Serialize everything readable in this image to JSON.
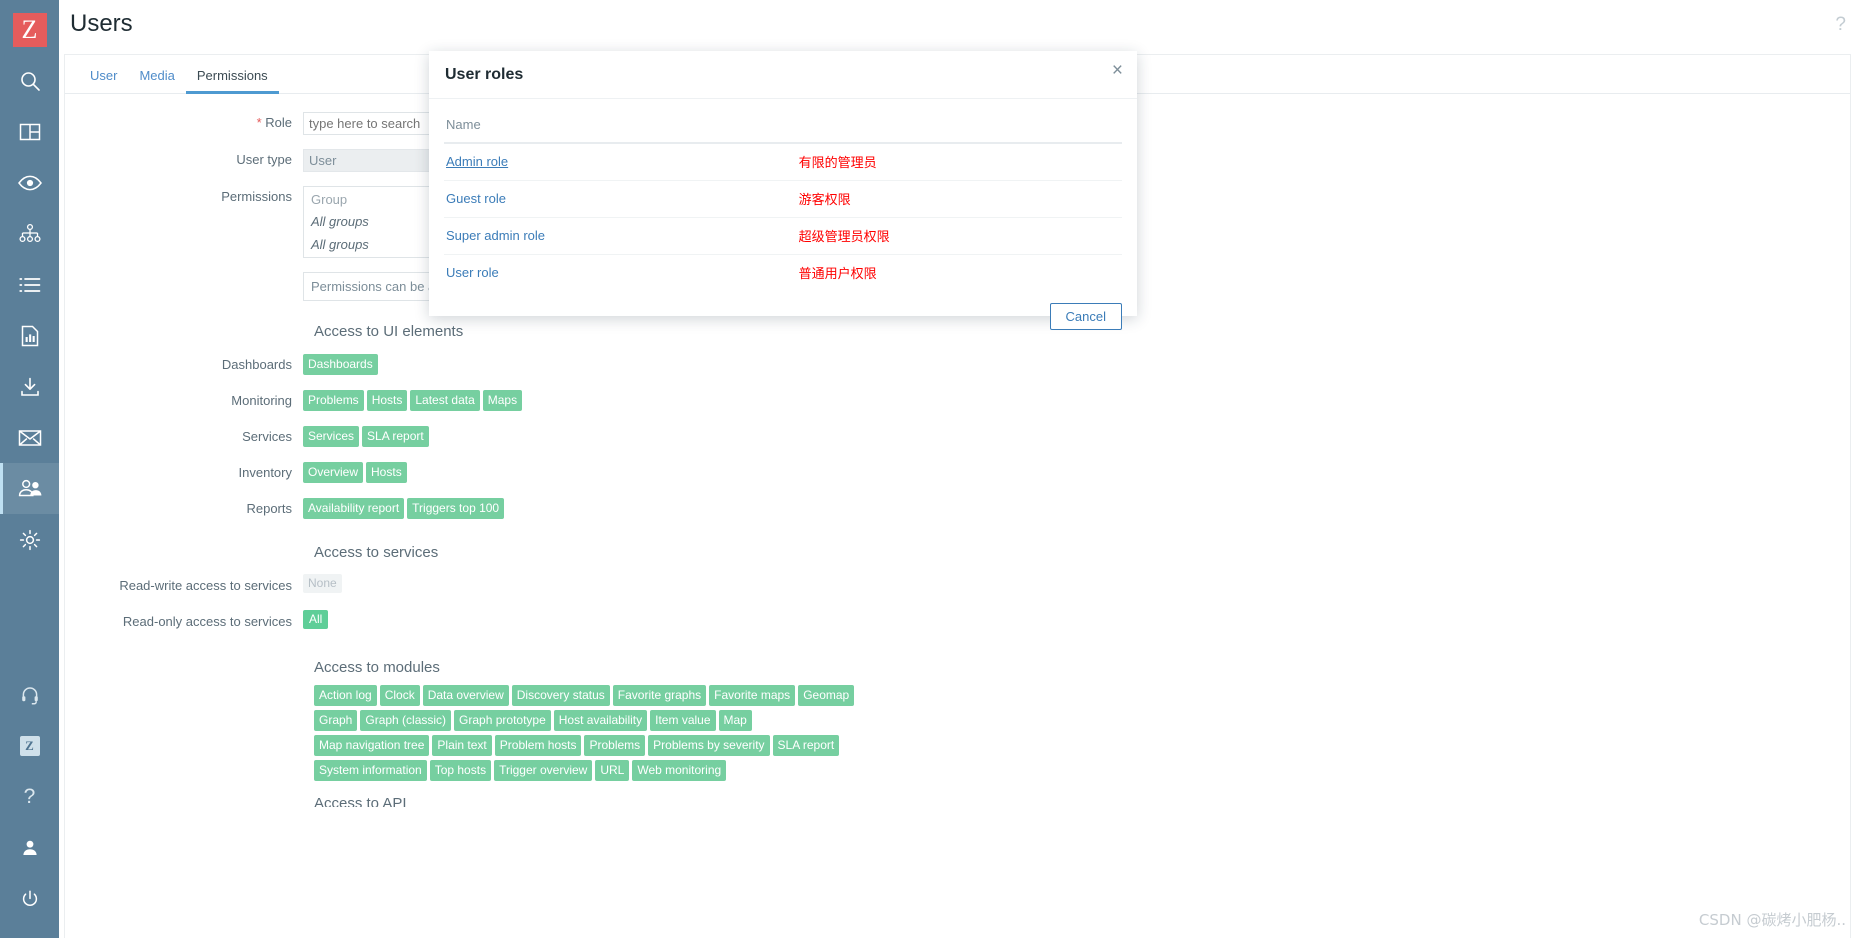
{
  "app": {
    "logo_letter": "Z",
    "page_title": "Users",
    "help_icon": "?"
  },
  "sidebar": {
    "items": [
      {
        "name": "search-icon",
        "label": "Search",
        "active": false
      },
      {
        "name": "dashboards-icon",
        "label": "Dashboards",
        "active": false
      },
      {
        "name": "monitoring-eye-icon",
        "label": "Monitoring",
        "active": false
      },
      {
        "name": "services-tree-icon",
        "label": "Services",
        "active": false
      },
      {
        "name": "inventory-list-icon",
        "label": "Inventory",
        "active": false
      },
      {
        "name": "reports-chart-icon",
        "label": "Reports",
        "active": false
      },
      {
        "name": "data-collection-icon",
        "label": "Data collection",
        "active": false
      },
      {
        "name": "alerts-envelope-icon",
        "label": "Alerts",
        "active": false
      },
      {
        "name": "users-icon",
        "label": "Users",
        "active": true
      },
      {
        "name": "administration-gear-icon",
        "label": "Administration",
        "active": false
      }
    ],
    "bottom_items": [
      {
        "name": "support-headset-icon",
        "label": "Support"
      },
      {
        "name": "zabbix-integrations-icon",
        "label": "Integrations",
        "glyph": "Z"
      },
      {
        "name": "help-question-icon",
        "label": "Help",
        "glyph": "?"
      },
      {
        "name": "user-profile-icon",
        "label": "User settings"
      },
      {
        "name": "power-signout-icon",
        "label": "Sign out"
      }
    ]
  },
  "tabs": [
    {
      "label": "User",
      "selected": false
    },
    {
      "label": "Media",
      "selected": false
    },
    {
      "label": "Permissions",
      "selected": true
    }
  ],
  "form": {
    "role": {
      "label": "Role",
      "required_marker": "*",
      "placeholder": "type here to search",
      "value": ""
    },
    "user_type": {
      "label": "User type",
      "value": "User"
    },
    "permissions": {
      "label": "Permissions",
      "column_header": "Group",
      "rows": [
        "All groups",
        "All groups"
      ],
      "note": "Permissions can be a"
    }
  },
  "ui_elements": {
    "title": "Access to UI elements",
    "groups": [
      {
        "label": "Dashboards",
        "tags": [
          "Dashboards"
        ]
      },
      {
        "label": "Monitoring",
        "tags": [
          "Problems",
          "Hosts",
          "Latest data",
          "Maps"
        ]
      },
      {
        "label": "Services",
        "tags": [
          "Services",
          "SLA report"
        ]
      },
      {
        "label": "Inventory",
        "tags": [
          "Overview",
          "Hosts"
        ]
      },
      {
        "label": "Reports",
        "tags": [
          "Availability report",
          "Triggers top 100"
        ]
      }
    ]
  },
  "services_access": {
    "title": "Access to services",
    "read_write": {
      "label": "Read-write access to services",
      "value": "None",
      "style": "none"
    },
    "read_only": {
      "label": "Read-only access to services",
      "value": "All",
      "style": "all"
    }
  },
  "modules": {
    "title": "Access to modules",
    "rows": [
      [
        "Action log",
        "Clock",
        "Data overview",
        "Discovery status",
        "Favorite graphs",
        "Favorite maps",
        "Geomap"
      ],
      [
        "Graph",
        "Graph (classic)",
        "Graph prototype",
        "Host availability",
        "Item value",
        "Map"
      ],
      [
        "Map navigation tree",
        "Plain text",
        "Problem hosts",
        "Problems",
        "Problems by severity",
        "SLA report"
      ],
      [
        "System information",
        "Top hosts",
        "Trigger overview",
        "URL",
        "Web monitoring"
      ]
    ]
  },
  "api_section": {
    "title": "Access to API"
  },
  "modal": {
    "title": "User roles",
    "close_glyph": "×",
    "column_header": "Name",
    "rows": [
      {
        "role": "Admin role",
        "annotation": "有限的管理员",
        "hovered": true
      },
      {
        "role": "Guest role",
        "annotation": "游客权限",
        "hovered": false
      },
      {
        "role": "Super admin role",
        "annotation": "超级管理员权限",
        "hovered": false
      },
      {
        "role": "User role",
        "annotation": "普通用户权限",
        "hovered": false
      }
    ],
    "cancel_label": "Cancel"
  },
  "watermark": {
    "text": "CSDN @碳烤小肥杨.."
  },
  "colors": {
    "sidebar_bg": "#5b7f99",
    "logo_red": "#e55c5c",
    "tag_green": "#76cfa0",
    "link_blue": "#3b7cb8",
    "annotation_red": "#ff0000",
    "tab_active": "#4e9ad1"
  }
}
